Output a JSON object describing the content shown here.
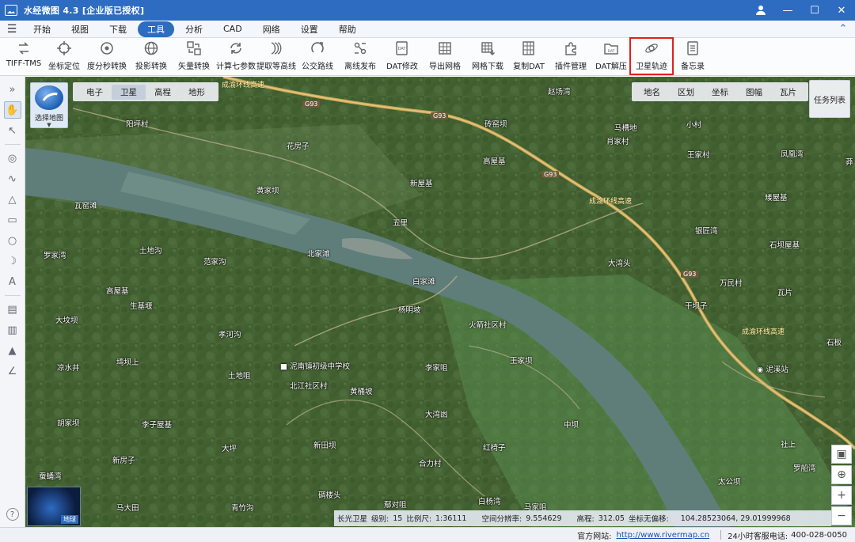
{
  "window": {
    "title": "水经微图 4.3 [企业版已授权]",
    "controls": [
      "user-icon",
      "minimize",
      "maximize",
      "close"
    ]
  },
  "menu": {
    "items": [
      "开始",
      "视图",
      "下载",
      "工具",
      "分析",
      "CAD",
      "网络",
      "设置",
      "帮助"
    ],
    "active": "工具"
  },
  "toolbar": {
    "tools": [
      {
        "label": "TIFF-TMS",
        "icon": "tiff-tms-icon"
      },
      {
        "label": "坐标定位",
        "icon": "crosshair-icon"
      },
      {
        "label": "度分秒转换",
        "icon": "dms-convert-icon"
      },
      {
        "label": "投影转换",
        "icon": "projection-icon"
      },
      {
        "label": "矢量转换",
        "icon": "vector-convert-icon"
      },
      {
        "label": "计算七参数",
        "icon": "seven-params-icon"
      },
      {
        "label": "提取等高线",
        "icon": "contour-icon"
      },
      {
        "label": "公交路线",
        "icon": "bus-route-icon"
      },
      {
        "label": "离线发布",
        "icon": "offline-publish-icon"
      },
      {
        "label": "DAT修改",
        "icon": "dat-edit-icon"
      },
      {
        "label": "导出网格",
        "icon": "export-grid-icon"
      },
      {
        "label": "网格下载",
        "icon": "grid-download-icon"
      },
      {
        "label": "复制DAT",
        "icon": "copy-dat-icon"
      },
      {
        "label": "插件管理",
        "icon": "plugin-icon"
      },
      {
        "label": "DAT解压",
        "icon": "dat-unzip-icon"
      },
      {
        "label": "卫星轨迹",
        "icon": "satellite-track-icon",
        "highlighted": true
      },
      {
        "label": "备忘录",
        "icon": "memo-icon"
      }
    ]
  },
  "map": {
    "layer_switcher": "选择地图",
    "basemap_tabs": [
      "电子",
      "卫星",
      "高程",
      "地形"
    ],
    "basemap_active": "卫星",
    "overlay_tabs": [
      "地名",
      "区划",
      "坐标",
      "图幅",
      "瓦片"
    ],
    "task_list": "任务列表",
    "mini_globe_label": "地球",
    "highway_code": "G93",
    "highway_name": "成渝环线高速",
    "places": [
      "阳坪村",
      "花房子",
      "黄家坝",
      "瓦窑滩",
      "新屋基",
      "五里",
      "高屋基",
      "砖窑坝",
      "赵场湾",
      "马槽地",
      "小村",
      "肖家村",
      "王家村",
      "凤凰湾",
      "矮屋基",
      "银匠湾",
      "石坝屋基",
      "大湾头",
      "万民村",
      "干坝子",
      "瓦片",
      "罗家湾",
      "土地沟",
      "范家沟",
      "北家滩",
      "白家滩",
      "杨明坡",
      "高屋基",
      "生基堰",
      "大坟坝",
      "孝河沟",
      "火箭社区村",
      "王家坝",
      "凉水井",
      "塆坝上",
      "土地咀",
      "北江社区村",
      "黄桶坡",
      "李家咀",
      "大湾凼",
      "胡家坝",
      "李子屋基",
      "大坪",
      "新田坝",
      "中坝",
      "红椅子",
      "新房子",
      "合力村",
      "社上",
      "罗船湾",
      "蚕蛹湾",
      "马大田",
      "青竹沟",
      "碉楼头",
      "鄢对咀",
      "白杨湾",
      "马家咀",
      "太公坝",
      "石板",
      "莽"
    ],
    "poi_school": "泥南镇初级中学校",
    "poi_station": "泥溪站",
    "status": {
      "source": "长光卫星",
      "level_label": "级别:",
      "level": "15",
      "scale_label": "比例尺:",
      "scale": "1:36111",
      "resolution_label": "空间分辨率:",
      "resolution": "9.554629",
      "elevation_label": "高程:",
      "elevation": "312.05",
      "offset_label": "坐标无偏移:",
      "coords": "104.28523064, 29.01999968"
    }
  },
  "footer": {
    "website_label": "官方网站:",
    "website": "http://www.rivermap.cn",
    "hotline_label": "24小时客服电话:",
    "hotline": "400-028-0050"
  }
}
